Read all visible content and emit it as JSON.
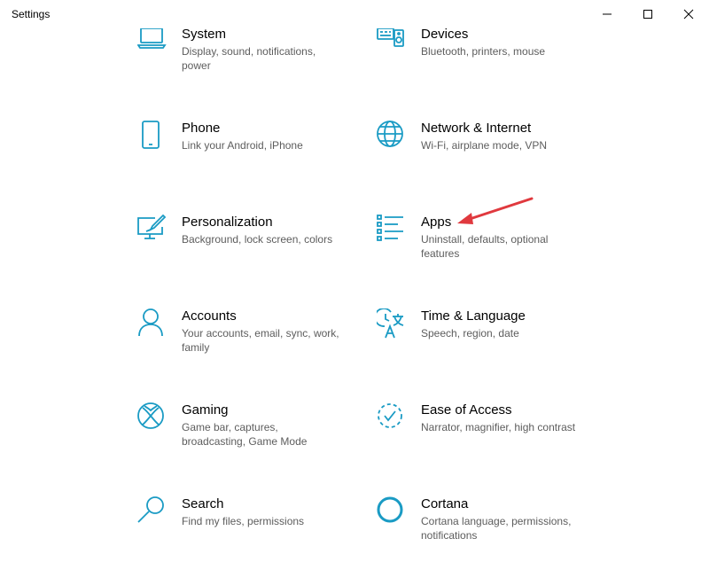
{
  "window": {
    "title": "Settings",
    "controls": {
      "minimize": "minimize-icon",
      "maximize": "maximize-icon",
      "close": "close-icon"
    }
  },
  "accent_color": "#1a9bc4",
  "annotation_color": "#e0393e",
  "tiles": [
    {
      "title": "System",
      "desc": "Display, sound, notifications, power",
      "icon": "laptop-icon"
    },
    {
      "title": "Devices",
      "desc": "Bluetooth, printers, mouse",
      "icon": "keyboard-speaker-icon"
    },
    {
      "title": "Phone",
      "desc": "Link your Android, iPhone",
      "icon": "phone-icon"
    },
    {
      "title": "Network & Internet",
      "desc": "Wi-Fi, airplane mode, VPN",
      "icon": "globe-icon"
    },
    {
      "title": "Personalization",
      "desc": "Background, lock screen, colors",
      "icon": "paint-monitor-icon"
    },
    {
      "title": "Apps",
      "desc": "Uninstall, defaults, optional features",
      "icon": "apps-list-icon"
    },
    {
      "title": "Accounts",
      "desc": "Your accounts, email, sync, work, family",
      "icon": "person-icon"
    },
    {
      "title": "Time & Language",
      "desc": "Speech, region, date",
      "icon": "time-language-icon"
    },
    {
      "title": "Gaming",
      "desc": "Game bar, captures, broadcasting, Game Mode",
      "icon": "xbox-icon"
    },
    {
      "title": "Ease of Access",
      "desc": "Narrator, magnifier, high contrast",
      "icon": "ease-of-access-icon"
    },
    {
      "title": "Search",
      "desc": "Find my files, permissions",
      "icon": "search-icon"
    },
    {
      "title": "Cortana",
      "desc": "Cortana language, permissions, notifications",
      "icon": "cortana-icon"
    }
  ]
}
